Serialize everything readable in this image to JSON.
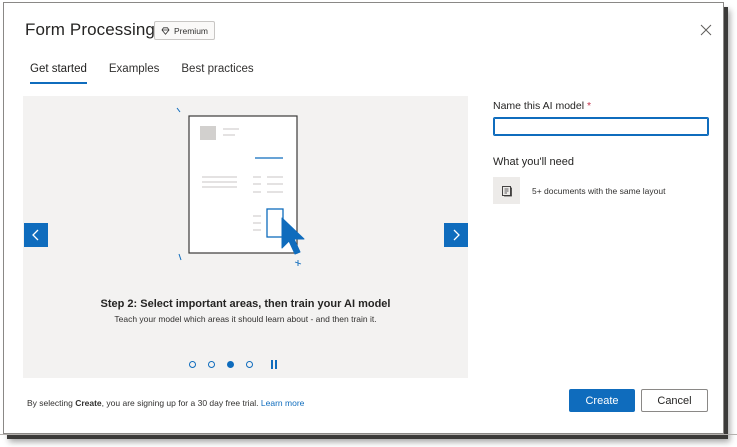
{
  "dialog": {
    "title": "Form Processing",
    "badge": "Premium"
  },
  "tabs": [
    {
      "label": "Get started",
      "active": true
    },
    {
      "label": "Examples",
      "active": false
    },
    {
      "label": "Best practices",
      "active": false
    }
  ],
  "carousel": {
    "step_title": "Step 2: Select important areas, then train your AI model",
    "step_subtitle": "Teach your model which areas it should learn about - and then train it.",
    "total_steps": 4,
    "current_step": 3
  },
  "form": {
    "name_label": "Name this AI model",
    "required_mark": "*",
    "name_value": "",
    "need_title": "What you'll need",
    "need_item": "5+ documents with the same layout"
  },
  "footer": {
    "text_before": "By selecting ",
    "text_bold": "Create",
    "text_after": ", you are signing up for a 30 day free trial. ",
    "link": "Learn more",
    "create_label": "Create",
    "cancel_label": "Cancel"
  },
  "colors": {
    "accent": "#0f6cbd",
    "carousel_bg": "#f3f2f1",
    "required": "#c4314b"
  }
}
